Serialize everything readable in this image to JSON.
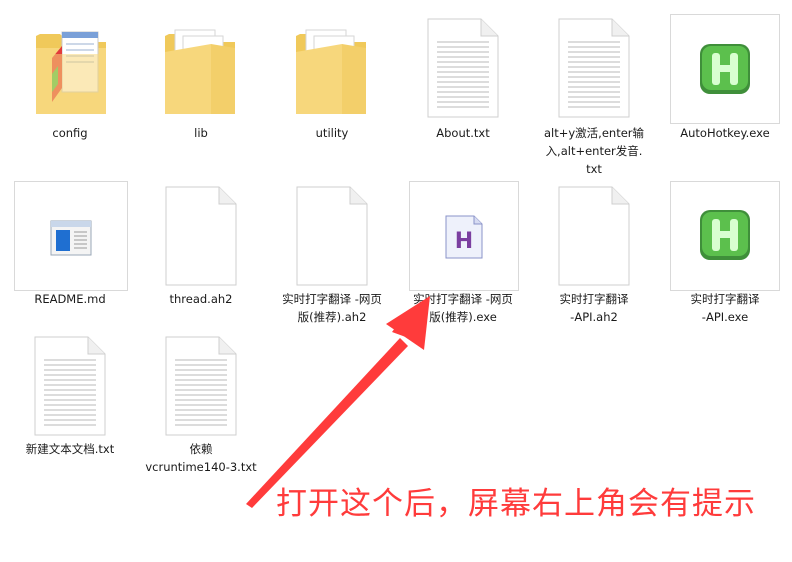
{
  "files": [
    {
      "label": "config",
      "icon": "folder-notepad-icon"
    },
    {
      "label": "lib",
      "icon": "folder-icon"
    },
    {
      "label": "utility",
      "icon": "folder-icon"
    },
    {
      "label": "About.txt",
      "icon": "text-file-icon"
    },
    {
      "label": "alt+y激活,enter输\n入,alt+enter发音.\ntxt",
      "icon": "text-file-icon"
    },
    {
      "label": "AutoHotkey.exe",
      "icon": "autohotkey-icon"
    },
    {
      "label": "README.md",
      "icon": "window-app-icon"
    },
    {
      "label": "thread.ah2",
      "icon": "blank-file-icon"
    },
    {
      "label": "实时打字翻译 -网页\n版(推荐).ah2",
      "icon": "blank-file-icon"
    },
    {
      "label": "实时打字翻译 -网页\n版(推荐).exe",
      "icon": "ah-exe-icon"
    },
    {
      "label": "实时打字翻译\n-API.ah2",
      "icon": "blank-file-icon"
    },
    {
      "label": "实时打字翻译\n-API.exe",
      "icon": "autohotkey-icon"
    },
    {
      "label": "新建文本文档.txt",
      "icon": "text-file-icon"
    },
    {
      "label": "依赖\nvcruntime140-3.txt",
      "icon": "text-file-icon"
    }
  ],
  "annotation": {
    "text": "打开这个后，屏幕右上角会有提示",
    "color": "#ff3b3b"
  },
  "colors": {
    "autohotkey_green": "#4caf50",
    "ah_purple": "#7b3fa0",
    "folder_yellow": "#f7d77c"
  }
}
